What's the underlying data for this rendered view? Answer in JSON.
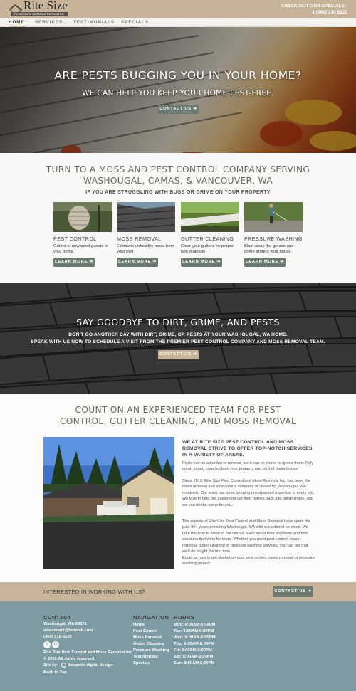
{
  "brand": {
    "name": "Rite Size",
    "tagline": "Pest Control and Moss Removal Inc"
  },
  "header": {
    "specials_link": "CHECK OUT OUR SPECIALS ›",
    "phone": "1 (360) 210 5220"
  },
  "nav": {
    "items": [
      {
        "label": "HOME",
        "active": true
      },
      {
        "label": "SERVICES",
        "active": false,
        "icon": "chevron-down-icon"
      },
      {
        "label": "TESTIMONIALS",
        "active": false
      },
      {
        "label": "SPECIALS",
        "active": false
      }
    ]
  },
  "hero": {
    "title": "ARE PESTS BUGGING YOU IN YOUR HOME?",
    "subtitle": "WE CAN HELP YOU KEEP YOUR HOME PEST-FREE.",
    "button": "CONTACT US ➔"
  },
  "services": {
    "heading": "TURN TO A MOSS AND PEST CONTROL COMPANY SERVING WASHOUGAL, CAMAS, & VANCOUVER, WA",
    "subheading": "IF YOU ARE STRUGGLING WITH BUGS OR GRIME ON YOUR PROPERTY",
    "cards": [
      {
        "title": "PEST CONTROL",
        "desc": "Get rid of unwanted guests in your home.",
        "button": "LEARN MORE ➔"
      },
      {
        "title": "MOSS REMOVAL",
        "desc": "Eliminate unhealthy moss from your roof.",
        "button": "LEARN MORE ➔"
      },
      {
        "title": "GUTTER CLEANING",
        "desc": "Clear your gutters for proper rain drainage.",
        "button": "LEARN MORE ➔"
      },
      {
        "title": "PRESSURE WASHING",
        "desc": "Blast away the grease and grime around your house.",
        "button": "LEARN MORE ➔"
      }
    ]
  },
  "goodbye": {
    "heading": "SAY GOODBYE TO DIRT, GRIME, AND PESTS",
    "line1": "DON'T GO ANOTHER DAY WITH DIRT, GRIME, OR PESTS AT YOUR WASHOUGAL, WA HOME.",
    "line2": "SPEAK WITH US NOW TO SCHEDULE A VISIT FROM THE PREMIER PEST CONTROL COMPANY AND MOSS REMOVAL TEAM.",
    "button": "CONTACT US ➔"
  },
  "team": {
    "heading": "COUNT ON AN EXPERIENCED TEAM FOR PEST CONTROL, GUTTER CLEANING, AND MOSS REMOVAL",
    "lead": "WE AT RITE SIZE PEST CONTROL AND MOSS REMOVAL STRIVE TO OFFER TOP-NOTCH SERVICES IN A VARIETY OF AREAS.",
    "p1": "Pests can be a burden to remove, but it can be worse to ignore them. Rely on an expert crew to clean your property and rid it of these issues.",
    "p2": "Since 2012, Rite Size Pest Control and Moss Removal Inc. has been the moss removal and pest control company of choice for Washougal, WA residents. Our team has been bringing unsurpassed expertise to every job. We love to help our customers get their homes back into tiptop shape, and we can do the same for you.",
    "p3": "The experts at Rite Size Pest Control and Moss Removal have spent the past 30+ years providing Washougal, WA with exceptional services. We take the time to listen to our clients, learn about their problems and find solutions that work for them. Whether you need pest control, moss removal, gutter cleaning or pressure washing services, you can bet that we'll do it right the first time.",
    "p4": "Email us now to get started on your pest control, moss removal or pressure washing project."
  },
  "cta": {
    "text": "INTERESTED IN WORKING WITH US?",
    "button": "CONTACT US ➔"
  },
  "footer": {
    "contact": {
      "heading": "CONTACT",
      "location": "Washougal, WA 98671",
      "email": "sleasman5@hotmail.com",
      "phone": "(360) 210-5220",
      "copyright": "Rite Size Pest Control and Moss Removal Inc.",
      "rights": "© 2020 All rights reserved.",
      "site_by_label": "Site by:",
      "site_by": "bespoke digital design",
      "back_to_top": "Back to Top"
    },
    "navigation": {
      "heading": "NAVIGATION",
      "links": [
        "Home",
        "Pest Control",
        "Moss Removal",
        "Gutter Cleaning",
        "Pressure Washing",
        "Testimonials",
        "Specials"
      ]
    },
    "hours": {
      "heading": "HOURS",
      "rows": [
        "Mon: 9:00AM-6:00PM",
        "Tue: 9:00AM-6:00PM",
        "Wed: 9:00AM-6:00PM",
        "Thu: 9:00AM-6:00PM",
        "Fri: 9:00AM-6:00PM",
        "Sat: 9:00AM-6:00PM",
        "Sun: 9:00AM-6:00PM"
      ]
    },
    "social": [
      "facebook-icon",
      "google-icon"
    ]
  },
  "colors": {
    "tan": "#c6b398",
    "button_gray": "#6b7b72",
    "footer_bg": "#7e9ba3"
  }
}
